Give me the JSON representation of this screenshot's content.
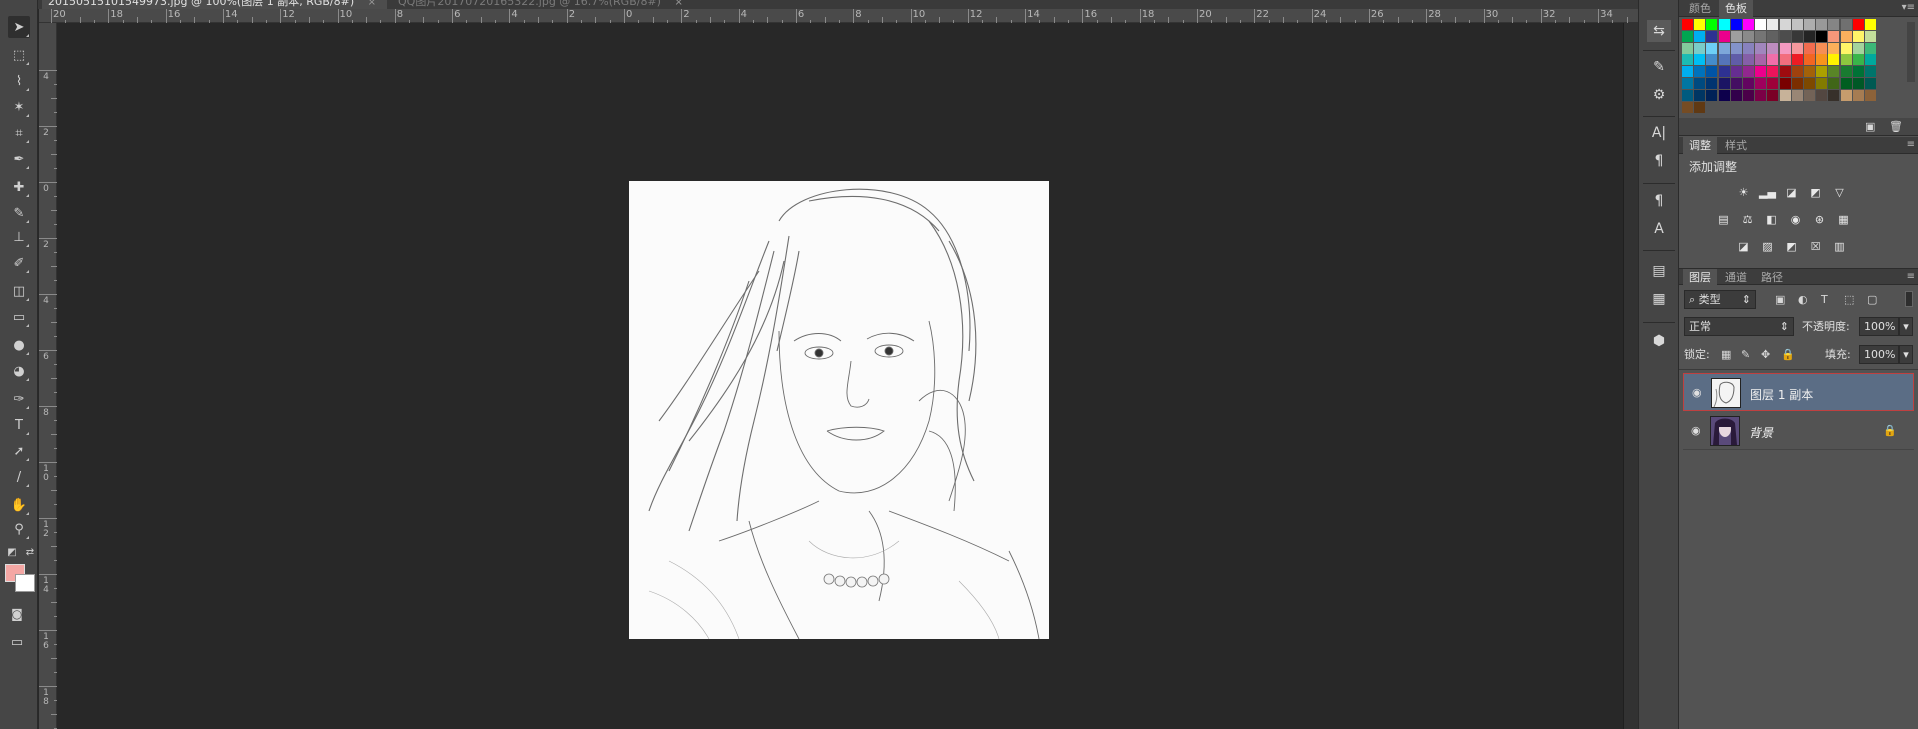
{
  "document_tabs": [
    {
      "title": "20150515101549973.jpg @ 100%(图层 1 副本, RGB/8#)",
      "close": "×"
    },
    {
      "title": "QQ图片20170720165322.jpg @ 16.7%(RGB/8#)",
      "close": "×"
    }
  ],
  "rulers": {
    "horizontal": [
      "20",
      "18",
      "16",
      "14",
      "12",
      "10",
      "8",
      "6",
      "4",
      "2",
      "0",
      "2",
      "4",
      "6",
      "8",
      "10",
      "12",
      "14",
      "16",
      "18",
      "20",
      "22",
      "24",
      "26",
      "28",
      "30",
      "32",
      "34"
    ],
    "vertical": [
      "4",
      "2",
      "0",
      "2",
      "4",
      "6",
      "8",
      "10",
      "12",
      "14",
      "16",
      "18"
    ]
  },
  "tools": [
    "move-tool",
    "marquee-tool",
    "lasso-tool",
    "magic-wand-tool",
    "crop-tool",
    "eyedropper-tool",
    "healing-brush-tool",
    "brush-tool",
    "clone-stamp-tool",
    "history-brush-tool",
    "eraser-tool",
    "gradient-tool",
    "blur-tool",
    "dodge-tool",
    "pen-tool",
    "type-tool",
    "path-selection-tool",
    "line-tool",
    "hand-tool",
    "zoom-tool"
  ],
  "colors": {
    "foreground": "#f4a7a4",
    "background": "#ffffff"
  },
  "right_panel": {
    "swatch_tabs": [
      "颜色",
      "色板"
    ],
    "swatch_active": "色板",
    "swatches": [
      "#ff0000",
      "#ffff00",
      "#00ff00",
      "#00ffff",
      "#0000ff",
      "#ff00ff",
      "#ffffff",
      "#ebebeb",
      "#d6d6d6",
      "#c2c2c2",
      "#adadad",
      "#999999",
      "#858585",
      "#707070",
      "#ff0000",
      "#ffff00",
      "#00a651",
      "#00aeef",
      "#2e3192",
      "#ec008c",
      "#9e9e9e",
      "#8a8a8a",
      "#757575",
      "#616161",
      "#4d4d4d",
      "#383838",
      "#242424",
      "#000000",
      "#f7977a",
      "#fbaf5d",
      "#fff568",
      "#c4df9b",
      "#82ca9c",
      "#7accc8",
      "#6dcff6",
      "#7da7d9",
      "#8393ca",
      "#8882be",
      "#a186be",
      "#bd8cbf",
      "#f49ac1",
      "#f5989d",
      "#f26c4f",
      "#f68e55",
      "#fbaf5a",
      "#fff467",
      "#a3d39c",
      "#3cb878",
      "#1cbbb4",
      "#00bff3",
      "#448ccb",
      "#5574b9",
      "#605ca8",
      "#855fa8",
      "#a864a8",
      "#f06eaa",
      "#f26d7d",
      "#ed1c24",
      "#f26522",
      "#f7941d",
      "#fff200",
      "#8dc73f",
      "#39b54a",
      "#00a99d",
      "#00aeef",
      "#0072bc",
      "#0054a6",
      "#2e3192",
      "#662d91",
      "#92278f",
      "#ec008c",
      "#ed145b",
      "#9e0b0f",
      "#a0410d",
      "#a36209",
      "#aba000",
      "#598527",
      "#197b30",
      "#007236",
      "#00746b",
      "#0076a3",
      "#004a80",
      "#003471",
      "#1b1464",
      "#440e62",
      "#630460",
      "#9e005d",
      "#9e0039",
      "#790000",
      "#7b2e00",
      "#7d4900",
      "#827b00",
      "#406618",
      "#005e20",
      "#005826",
      "#005952",
      "#005b7f",
      "#003663",
      "#002157",
      "#0d004c",
      "#32004b",
      "#4b0049",
      "#7b0046",
      "#7a0026",
      "#c7b299",
      "#998675",
      "#736357",
      "#534741",
      "#37302a",
      "#c69c6d",
      "#a67c52",
      "#8c6239",
      "#754c24",
      "#603913"
    ],
    "adjust_tabs": [
      "调整",
      "样式"
    ],
    "adjust_title": "添加调整",
    "layers_tabs": [
      "图层",
      "通道",
      "路径"
    ],
    "layer_filter": "类型",
    "blend_mode": "正常",
    "opacity_label": "不透明度:",
    "opacity_value": "100%",
    "lock_label": "锁定:",
    "fill_label": "填充:",
    "fill_value": "100%",
    "layers": [
      {
        "name": "图层 1 副本",
        "selected": true,
        "visible": true,
        "locked": false
      },
      {
        "name": "背景",
        "selected": false,
        "visible": true,
        "locked": true
      }
    ]
  }
}
